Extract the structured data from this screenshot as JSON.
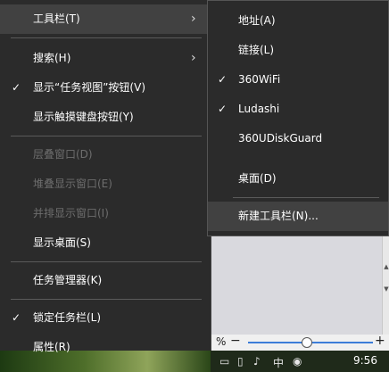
{
  "main_menu": {
    "items": [
      {
        "label": "工具栏(T)",
        "has_submenu": true,
        "checked": false,
        "disabled": false
      },
      {
        "label": "搜索(H)",
        "has_submenu": true,
        "checked": false,
        "disabled": false
      },
      {
        "label": "显示“任务视图”按钮(V)",
        "has_submenu": false,
        "checked": true,
        "disabled": false
      },
      {
        "label": "显示触摸键盘按钮(Y)",
        "has_submenu": false,
        "checked": false,
        "disabled": false
      },
      {
        "label": "层叠窗口(D)",
        "has_submenu": false,
        "checked": false,
        "disabled": true
      },
      {
        "label": "堆叠显示窗口(E)",
        "has_submenu": false,
        "checked": false,
        "disabled": true
      },
      {
        "label": "并排显示窗口(I)",
        "has_submenu": false,
        "checked": false,
        "disabled": true
      },
      {
        "label": "显示桌面(S)",
        "has_submenu": false,
        "checked": false,
        "disabled": false
      },
      {
        "label": "任务管理器(K)",
        "has_submenu": false,
        "checked": false,
        "disabled": false
      },
      {
        "label": "锁定任务栏(L)",
        "has_submenu": false,
        "checked": true,
        "disabled": false
      },
      {
        "label": "属性(R)",
        "has_submenu": false,
        "checked": false,
        "disabled": false
      }
    ]
  },
  "toolbars_submenu": {
    "items": [
      {
        "label": "地址(A)",
        "checked": false
      },
      {
        "label": "链接(L)",
        "checked": false
      },
      {
        "label": "360WiFi",
        "checked": true
      },
      {
        "label": "Ludashi",
        "checked": true
      },
      {
        "label": "360UDiskGuard",
        "checked": false
      },
      {
        "label": "桌面(D)",
        "checked": false
      },
      {
        "label": "新建工具栏(N)...",
        "checked": false
      }
    ]
  },
  "glyphs": {
    "check": "✓",
    "chevron": "›"
  },
  "zoom": {
    "percent_symbol": "%",
    "minus": "−",
    "plus": "+",
    "level_fraction": 0.47
  },
  "taskbar": {
    "clock": "9:56",
    "ime_label": "中"
  },
  "colors": {
    "menu_bg": "#2b2b2b",
    "hover_bg": "#414141",
    "disabled_text": "#6d6d6d",
    "zoom_accent": "#3c7dd8"
  }
}
